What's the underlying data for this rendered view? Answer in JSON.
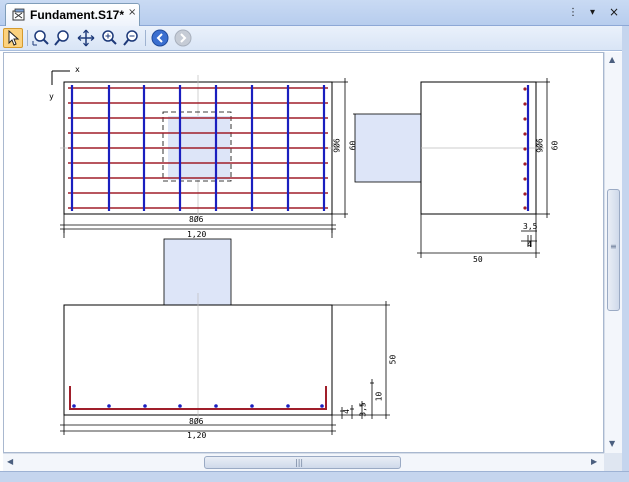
{
  "window": {
    "tab_title": "Fundament.S17*",
    "close_glyph": "×",
    "pin_glyph": "⋮",
    "menu_glyph": "▾",
    "win_close_glyph": "×"
  },
  "toolbar": {
    "tools": [
      {
        "name": "select-arrow-icon",
        "active": true
      },
      {
        "name": "zoom-window-icon",
        "active": false
      },
      {
        "name": "zoom-icon",
        "active": false
      },
      {
        "name": "pan-icon",
        "active": false
      },
      {
        "name": "zoom-in-icon",
        "active": false
      },
      {
        "name": "zoom-out-icon",
        "active": false
      },
      {
        "name": "back-icon",
        "active": false
      },
      {
        "name": "forward-icon",
        "active": false
      }
    ]
  },
  "drawing": {
    "axis_x": "x",
    "axis_y": "y",
    "plan_bottom_rebar": "8Ø6",
    "plan_width": "1,20",
    "plan_side_rebar": "9Ø6",
    "plan_column": "60",
    "side_rebar": "9Ø6",
    "side_height": "60",
    "side_cover": "3,5",
    "side_cover_small": "4",
    "side_width": "50",
    "section_rebar": "8Ø6",
    "section_width": "1,20",
    "section_height": "50",
    "section_dim_10": "10",
    "section_dim_35": "3,5",
    "section_dim_4": "4"
  },
  "scrollbar": {
    "grip_h": "|||",
    "grip_v": "≡",
    "arrow_up": "▲",
    "arrow_down": "▼",
    "arrow_left": "◀",
    "arrow_right": "▶"
  },
  "colors": {
    "rebar_red": "#a01e2a",
    "rebar_blue": "#1a1fbf",
    "column_fill": "#dde5f8"
  }
}
